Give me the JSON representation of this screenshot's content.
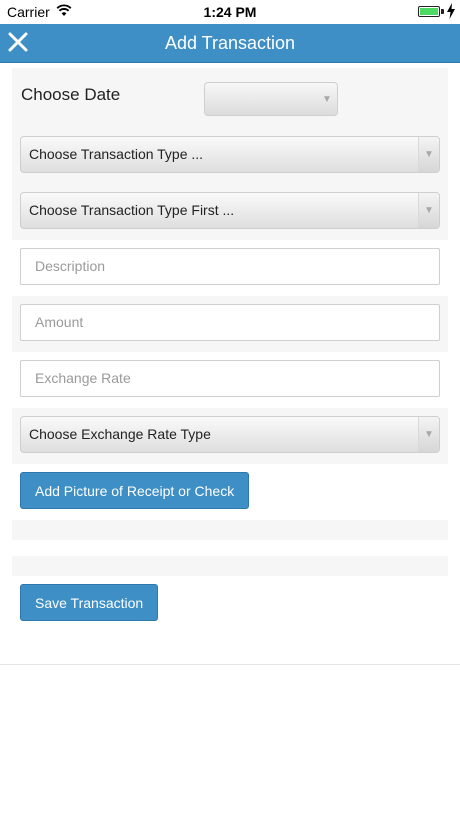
{
  "status_bar": {
    "carrier": "Carrier",
    "time": "1:24 PM",
    "battery_color": "#4cd964"
  },
  "navbar": {
    "title": "Add Transaction",
    "close_icon": "close-icon",
    "color": "#3d8fc5"
  },
  "form": {
    "date_label": "Choose Date",
    "date_value": "",
    "transaction_type_placeholder": "Choose Transaction Type ...",
    "transaction_subtype_placeholder": "Choose Transaction Type First ...",
    "description_placeholder": "Description",
    "amount_placeholder": "Amount",
    "exchange_rate_placeholder": "Exchange Rate",
    "exchange_rate_type_placeholder": "Choose Exchange Rate Type",
    "add_picture_label": "Add Picture of Receipt or Check",
    "save_label": "Save Transaction"
  }
}
